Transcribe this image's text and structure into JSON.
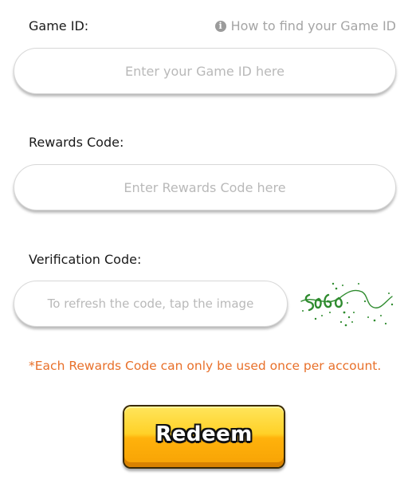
{
  "game_id": {
    "label": "Game ID:",
    "help_link": "How to find your Game ID",
    "placeholder": "Enter your Game ID here",
    "value": ""
  },
  "rewards_code": {
    "label": "Rewards Code:",
    "placeholder": "Enter Rewards Code here",
    "value": ""
  },
  "verification_code": {
    "label": "Verification Code:",
    "placeholder": "To refresh the code, tap the image",
    "value": ""
  },
  "notice": "*Each Rewards Code can only be used once per account.",
  "redeem_button": "Redeem",
  "colors": {
    "notice": "#e8702a",
    "button_gradient_top": "#ffe55b",
    "button_gradient_bottom": "#f7a204",
    "captcha_green": "#2e8b2e"
  },
  "icons": {
    "help": "info-icon",
    "captcha": "captcha-image"
  }
}
